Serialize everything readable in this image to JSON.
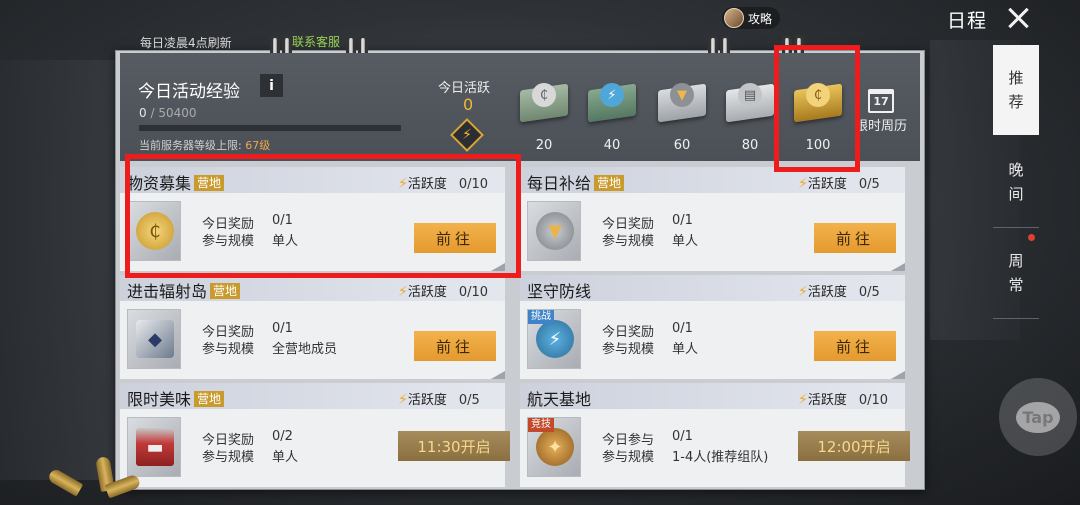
{
  "top_bar": {
    "guide_label": "攻略",
    "title": "日程"
  },
  "side_tabs": [
    {
      "label": "推荐",
      "chars": [
        "推",
        "荐"
      ],
      "active": true
    },
    {
      "label": "晚间",
      "chars": [
        "晚",
        "间"
      ],
      "active": false
    },
    {
      "label": "周常",
      "chars": [
        "周",
        "常"
      ],
      "active": false,
      "has_dot": true
    }
  ],
  "tap_label": "Tap",
  "board": {
    "refresh_note": "每日凌晨4点刷新",
    "customer_service": "联系客服"
  },
  "header": {
    "exp_title": "今日活动经验",
    "info_label": "i",
    "exp_current": "0",
    "exp_sep": "/",
    "exp_max": "50400",
    "exp_progress": 0,
    "server_cap_prefix": "当前服务器等级上限: ",
    "server_cap_level": "67级",
    "activity_label": "今日活跃",
    "activity_value": "0",
    "rewards": [
      {
        "value": "20",
        "icon": "silver-coin-crate-icon",
        "color": "#8fa18c"
      },
      {
        "value": "40",
        "icon": "energy-crate-icon",
        "color": "#6d9479"
      },
      {
        "value": "60",
        "icon": "silver-shield-crate-icon",
        "color": "#b8bdc2"
      },
      {
        "value": "80",
        "icon": "silver-ammo-crate-icon",
        "color": "#c5c8cb"
      },
      {
        "value": "100",
        "icon": "gold-coin-crate-icon",
        "color": "#d7a73a"
      }
    ],
    "timed_week_label": "限时周历",
    "calendar_day": "17"
  },
  "activities": [
    {
      "name": "物资募集",
      "tag": "营地",
      "activity_label": "活跃度",
      "activity_value": "0/10",
      "row1_label": "今日奖励",
      "row1_value": "0/1",
      "row2_label": "参与规模",
      "row2_value": "单人",
      "button": "前往",
      "icon": "gold-coin-icon"
    },
    {
      "name": "每日补给",
      "tag": "营地",
      "activity_label": "活跃度",
      "activity_value": "0/5",
      "row1_label": "今日奖励",
      "row1_value": "0/1",
      "row2_label": "参与规模",
      "row2_value": "单人",
      "button": "前往",
      "icon": "silver-shield-icon"
    },
    {
      "name": "进击辐射岛",
      "tag": "营地",
      "activity_label": "活跃度",
      "activity_value": "0/10",
      "row1_label": "今日奖励",
      "row1_value": "0/1",
      "row2_label": "参与规模",
      "row2_value": "全营地成员",
      "button": "前往",
      "icon": "gem-crate-icon"
    },
    {
      "name": "坚守防线",
      "tag": "",
      "icon_tag": "挑战",
      "activity_label": "活跃度",
      "activity_value": "0/5",
      "row1_label": "今日奖励",
      "row1_value": "0/1",
      "row2_label": "参与规模",
      "row2_value": "单人",
      "button": "前往",
      "icon": "energy-shield-icon"
    },
    {
      "name": "限时美味",
      "tag": "营地",
      "activity_label": "活跃度",
      "activity_value": "0/5",
      "row1_label": "今日奖励",
      "row1_value": "0/2",
      "row2_label": "参与规模",
      "row2_value": "单人",
      "button": "11:30开启",
      "icon": "red-chest-icon"
    },
    {
      "name": "航天基地",
      "tag": "",
      "icon_tag": "竞技",
      "activity_label": "活跃度",
      "activity_value": "0/10",
      "row1_label": "今日参与",
      "row1_value": "0/1",
      "row2_label": "参与规模",
      "row2_value": "1-4人(推荐组队)",
      "button": "12:00开启",
      "icon": "bronze-medal-icon"
    }
  ]
}
